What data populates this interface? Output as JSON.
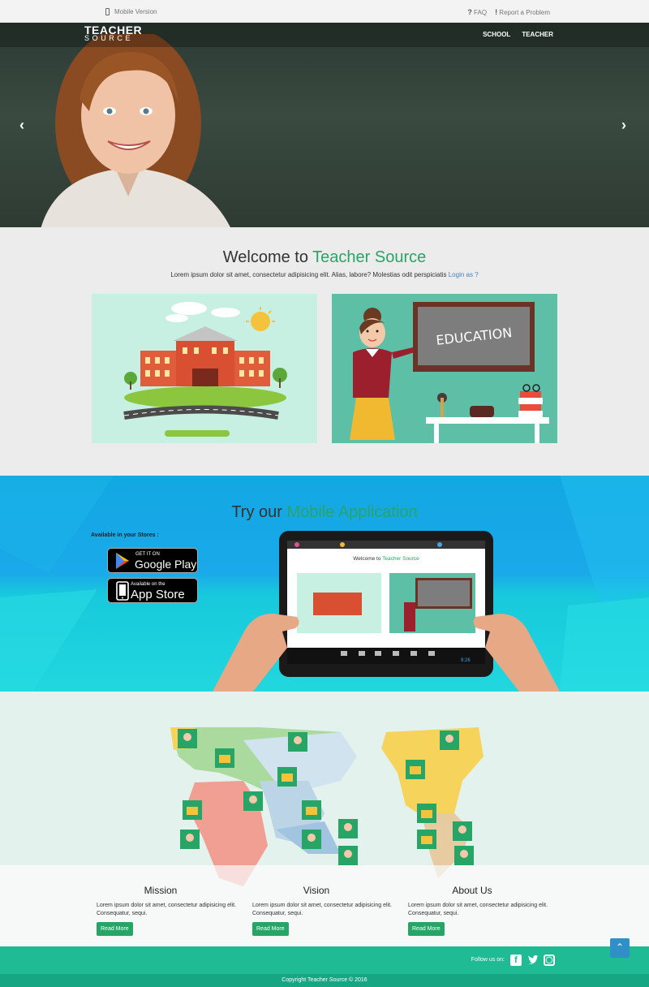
{
  "topbar": {
    "mobile_label": "Mobile Version",
    "faq_label": "FAQ",
    "report_label": "Report a Problem"
  },
  "header": {
    "logo_line1": "TEACHER",
    "logo_line2": "SOURCE",
    "nav": [
      "SCHOOL",
      "TEACHER"
    ]
  },
  "hero": {
    "prev_icon": "chevron-left-icon",
    "next_icon": "chevron-right-icon"
  },
  "welcome": {
    "title_prefix": "Welcome to ",
    "title_accent": "Teacher Source",
    "text": "Lorem ipsum dolor sit amet, consectetur adipisicing elit. Alias, labore? Molestias odit perspiciatis ",
    "login_link": "Login as ?",
    "teacher_card_board_text": "EDUCATION"
  },
  "app_section": {
    "title_prefix": "Try our ",
    "title_accent": "Mobile Application",
    "stores_label": "Available in your Stores :",
    "google_play_small": "GET IT ON",
    "google_play_big": "Google Play",
    "app_store_small": "Available on the",
    "app_store_big": "App Store",
    "tablet_screen_title_prefix": "Welcome to ",
    "tablet_screen_title_accent": "Teacher Source",
    "tablet_clock": "9:26"
  },
  "info": {
    "columns": [
      {
        "title": "Mission",
        "text": "Lorem ipsum dolor sit amet, consectetur adipisicing elit. Consequatur, sequi.",
        "button": "Read More"
      },
      {
        "title": "Vision",
        "text": "Lorem ipsum dolor sit amet, consectetur adipisicing elit. Consequatur, sequi.",
        "button": "Read More"
      },
      {
        "title": "About Us",
        "text": "Lorem ipsum dolor sit amet, consectetur adipisicing elit. Consequatur, sequi.",
        "button": "Read More"
      }
    ]
  },
  "footer": {
    "follow_label": "Follow us on:",
    "social": [
      "facebook-icon",
      "twitter-icon",
      "instagram-icon"
    ],
    "copyright": "Copyright Teacher Source © 2016"
  },
  "colors": {
    "accent_green": "#27a567",
    "link_blue": "#3b86c6",
    "footer_teal": "#1fbb95",
    "scroll_top_blue": "#2f8fc6"
  }
}
